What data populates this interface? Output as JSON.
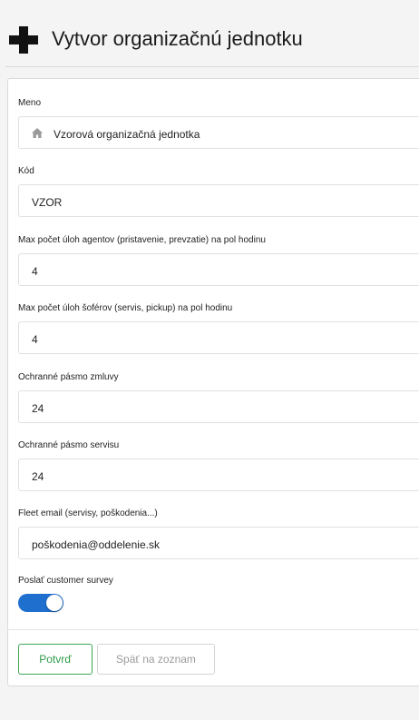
{
  "header": {
    "title": "Vytvor organizačnú jednotku",
    "icon": "plus-icon"
  },
  "form": {
    "name": {
      "label": "Meno",
      "value": "Vzorová organizačná jednotka",
      "icon": "home-icon"
    },
    "code": {
      "label": "Kód",
      "value": "VZOR"
    },
    "agent_tasks": {
      "label": "Max počet úloh agentov (pristavenie, prevzatie) na pol hodinu",
      "value": "4"
    },
    "driver_tasks": {
      "label": "Max počet úloh šoférov (servis, pickup) na pol hodinu",
      "value": "4"
    },
    "contract_buffer": {
      "label": "Ochranné pásmo zmluvy",
      "value": "24"
    },
    "service_buffer": {
      "label": "Ochranné pásmo servisu",
      "value": "24"
    },
    "fleet_email": {
      "label": "Fleet email (servisy, poškodenia...)",
      "value": "poškodenia@oddelenie.sk"
    },
    "survey": {
      "label": "Poslať customer survey",
      "enabled": true
    }
  },
  "actions": {
    "confirm_label": "Potvrď",
    "back_label": "Späť na zoznam"
  },
  "colors": {
    "toggle_on": "#1e6fce",
    "confirm_border": "#3fa655"
  }
}
